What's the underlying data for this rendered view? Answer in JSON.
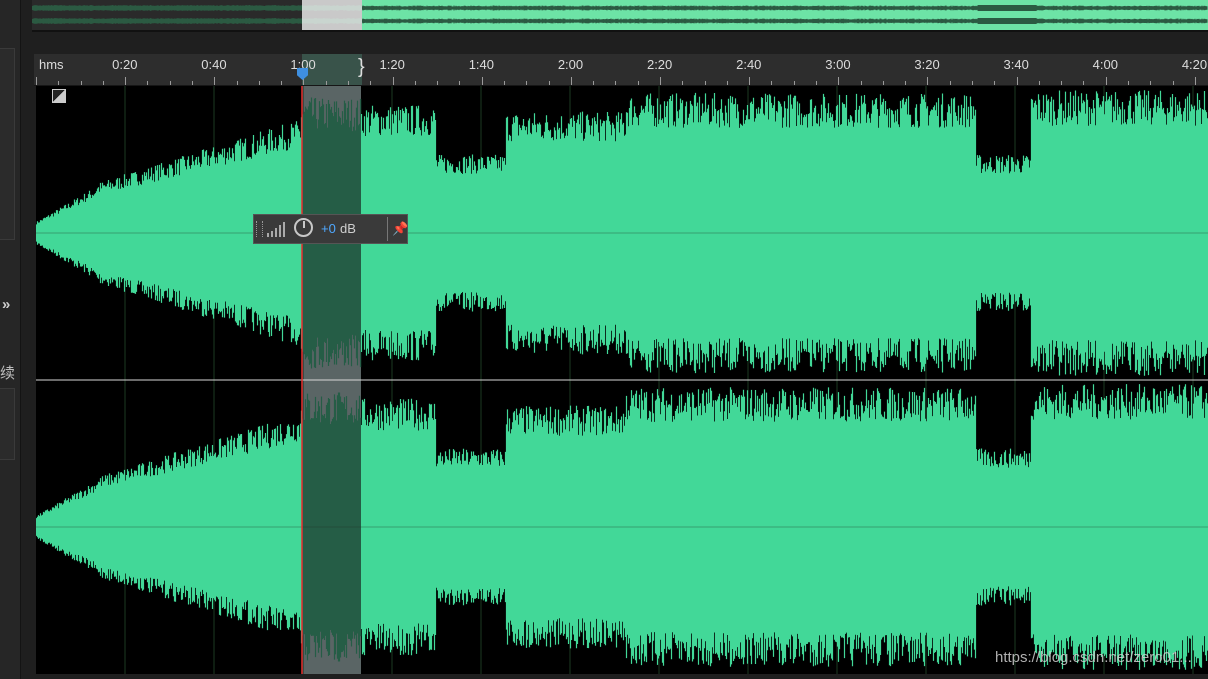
{
  "side_panel": {
    "expand_icon": "double-chevron-right-icon",
    "expand_glyph": "»",
    "cut_char": "续"
  },
  "timeline": {
    "unit_label": "hms",
    "ticks": [
      "0:20",
      "0:40",
      "1:00",
      "1:20",
      "1:40",
      "2:00",
      "2:20",
      "2:40",
      "3:00",
      "3:20",
      "3:40",
      "4:00",
      "4:20"
    ]
  },
  "selection": {
    "start_time": "1:00",
    "end_time": "1:20"
  },
  "hud": {
    "gain_value": "+0",
    "gain_unit": "dB",
    "volume_icon": "volume-bars-icon",
    "knob_icon": "gain-knob-icon",
    "pin_icon": "pin-icon"
  },
  "colors": {
    "waveform": "#42d898",
    "overview_waveform": "#6de3a6",
    "selection_bg": "#f0f0ff",
    "selection_header": "#3c5a50",
    "playhead": "#e83030",
    "playhead_marker": "#3e8fe0",
    "accent_blue": "#4fa8ff"
  },
  "watermark": "https://blog.csdn.net/zero01..."
}
